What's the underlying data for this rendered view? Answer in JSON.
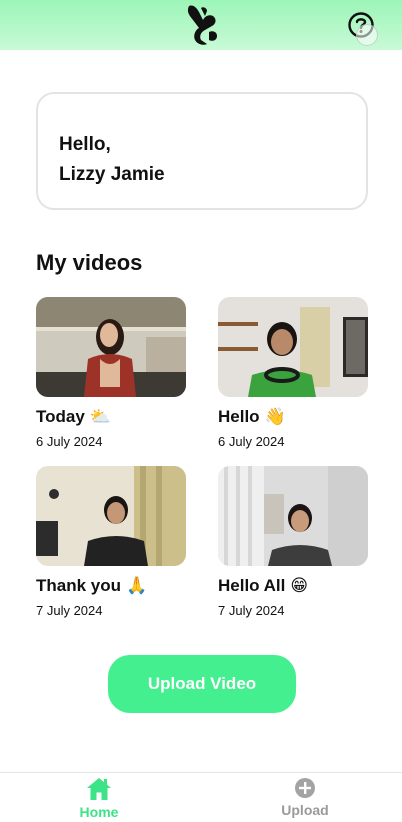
{
  "header": {
    "logo_icon": "hands-sign-logo-icon",
    "help_icon": "question-mark-icon"
  },
  "greeting": {
    "line1": "Hello,",
    "line2": "Lizzy Jamie"
  },
  "videos_section": {
    "title": "My videos",
    "items": [
      {
        "title": "Today",
        "emoji": "⛅",
        "date": "6 July 2024"
      },
      {
        "title": "Hello",
        "emoji": "👋",
        "date": "6 July 2024"
      },
      {
        "title": "Thank you",
        "emoji": "🙏",
        "date": "7 July 2024"
      },
      {
        "title": "Hello All",
        "emoji": "😁",
        "date": "7 July 2024"
      }
    ]
  },
  "upload_button": {
    "label": "Upload Video"
  },
  "bottom_nav": {
    "items": [
      {
        "label": "Home",
        "icon": "home-icon",
        "active": true
      },
      {
        "label": "Upload",
        "icon": "plus-circle-icon",
        "active": false
      }
    ]
  },
  "colors": {
    "accent": "#44ef8f",
    "header_gradient_top": "#9cf5b8",
    "inactive_nav": "#9a9a9a"
  }
}
